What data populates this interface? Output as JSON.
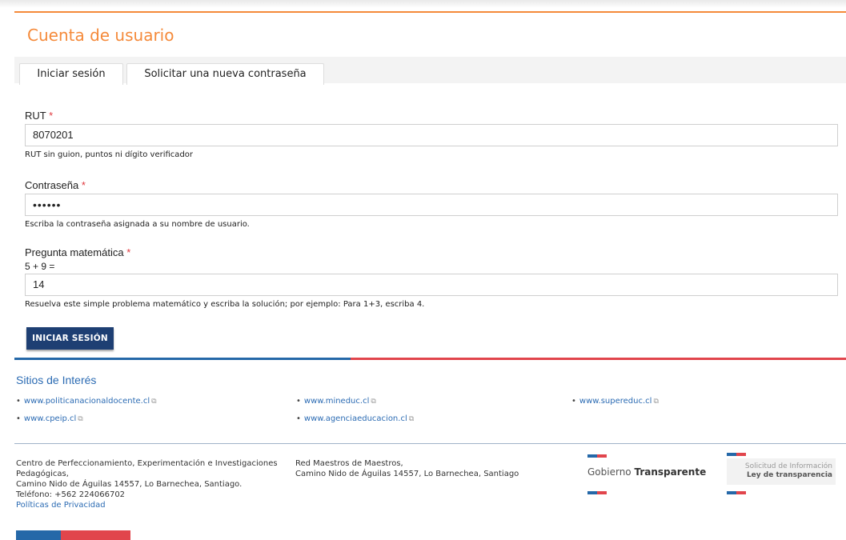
{
  "page": {
    "title": "Cuenta de usuario"
  },
  "tabs": [
    {
      "label": "Iniciar sesión"
    },
    {
      "label": "Solicitar una nueva contraseña"
    }
  ],
  "form": {
    "rut": {
      "label": "RUT",
      "required": "*",
      "value": "8070201",
      "help": "RUT sin guion, puntos ni dígito verificador"
    },
    "password": {
      "label": "Contraseña",
      "required": "*",
      "value": "••••••",
      "help": "Escriba la contraseña asignada a su nombre de usuario."
    },
    "math": {
      "label": "Pregunta matemática",
      "required": "*",
      "question": "5 + 9 =",
      "value": "14",
      "help": "Resuelva este simple problema matemático y escriba la solución; por ejemplo: Para 1+3, escriba 4."
    },
    "submit_label": "INICIAR SESIÓN"
  },
  "sitios": {
    "title": "Sitios de Interés",
    "links": [
      "www.politicanacionaldocente.cl",
      "www.mineduc.cl",
      "www.supereduc.cl",
      "www.cpeip.cl",
      "www.agenciaeducacion.cl"
    ]
  },
  "footer": {
    "cpeip": {
      "line1": "Centro de Perfeccionamiento, Experimentación e Investigaciones",
      "line2": "Pedagógicas,",
      "line3": "Camino Nido de Águilas 14557, Lo Barnechea, Santiago.",
      "line4": "Teléfono: +562 224066702",
      "privacy": "Políticas de Privacidad"
    },
    "rmm": {
      "line1": "Red Maestros de Maestros,",
      "line2": "Camino Nido de Águilas 14557, Lo Barnechea, Santiago"
    },
    "gobierno": {
      "word1": "Gobierno",
      "word2": "Transparente"
    },
    "ley": {
      "line1": "Solicitud de Información",
      "line2": "Ley de transparencia"
    }
  },
  "colors": {
    "accent_orange": "#f58a3a",
    "button_blue": "#1e3f73",
    "link_blue": "#2b6bb3",
    "gob_blue": "#2568a8",
    "gob_red": "#e1454c"
  },
  "icons": {
    "external_link": "external-link-icon"
  }
}
